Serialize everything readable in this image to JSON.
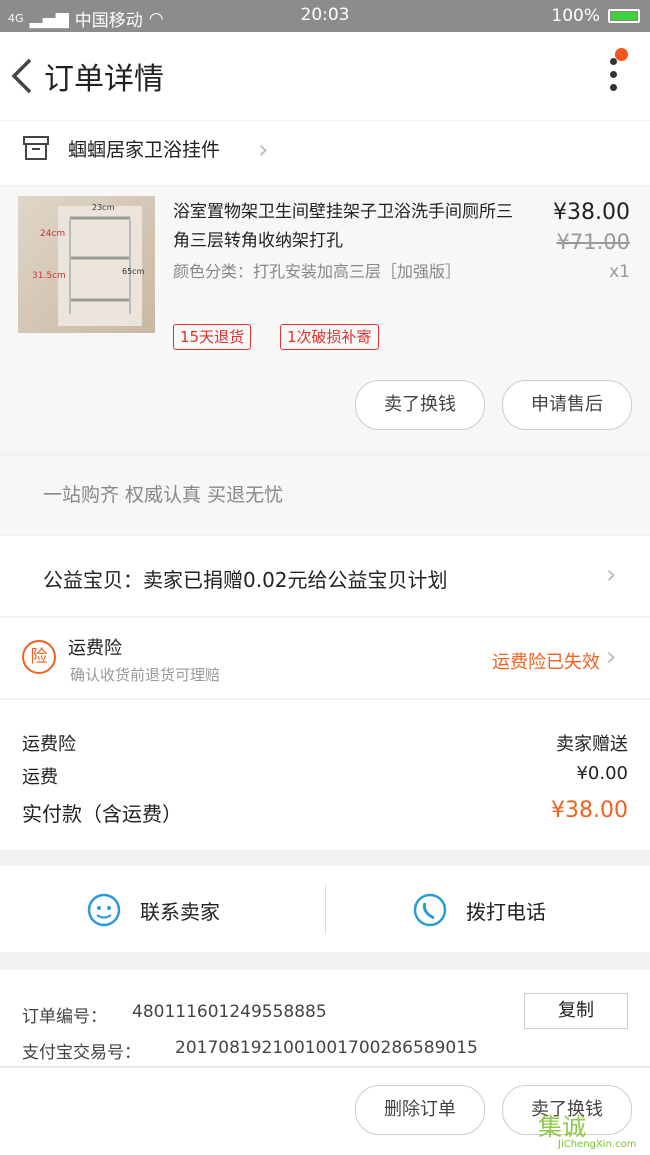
{
  "status": {
    "carrier": "中国移动",
    "signal_prefix": "4G",
    "time": "20:03",
    "battery": "100%"
  },
  "header": {
    "title": "订单详情"
  },
  "store": {
    "name": "蝈蝈居家卫浴挂件"
  },
  "product": {
    "title": "浴室置物架卫生间壁挂架子卫浴洗手间厕所三角三层转角收纳架打孔",
    "spec": "颜色分类：打孔安装加高三层［加强版］",
    "price": "¥38.00",
    "original_price": "¥71.00",
    "quantity": "x1",
    "tags": [
      "15天退货",
      "1次破损补寄"
    ],
    "thumb_labels": [
      "24cm",
      "31.5cm",
      "65cm",
      "23cm"
    ],
    "buttons": {
      "buy_again": "卖了换钱",
      "after_sale": "申请售后"
    }
  },
  "slogan": "一站购齐  权威认真  买退无忧",
  "charity": "公益宝贝：卖家已捐赠0.02元给公益宝贝计划",
  "insurance": {
    "icon_text": "险",
    "title": "运费险",
    "subtitle": "确认收货前退货可理赔",
    "status": "运费险已失效",
    "status_color": "#f06220"
  },
  "fees": {
    "rows": [
      {
        "label": "运费险",
        "value": "卖家赠送"
      },
      {
        "label": "运费",
        "value": "¥0.00"
      },
      {
        "label": "实付款（含运费）",
        "value": "¥38.00"
      }
    ],
    "accent": "#f06220"
  },
  "contact": {
    "seller": "联系卖家",
    "call": "拨打电话",
    "icon_color": "#2b9bd8"
  },
  "order_info": {
    "order_no_label": "订单编号：",
    "order_no": "480111601249558885",
    "copy": "复制",
    "alipay_label": "支付宝交易号：",
    "alipay_no": "2017081921001001700286589015"
  },
  "actions": {
    "delete": "删除订单",
    "sell": "卖了换钱"
  },
  "watermark": {
    "brand": "集诚",
    "url": "JiChengXin.com"
  }
}
